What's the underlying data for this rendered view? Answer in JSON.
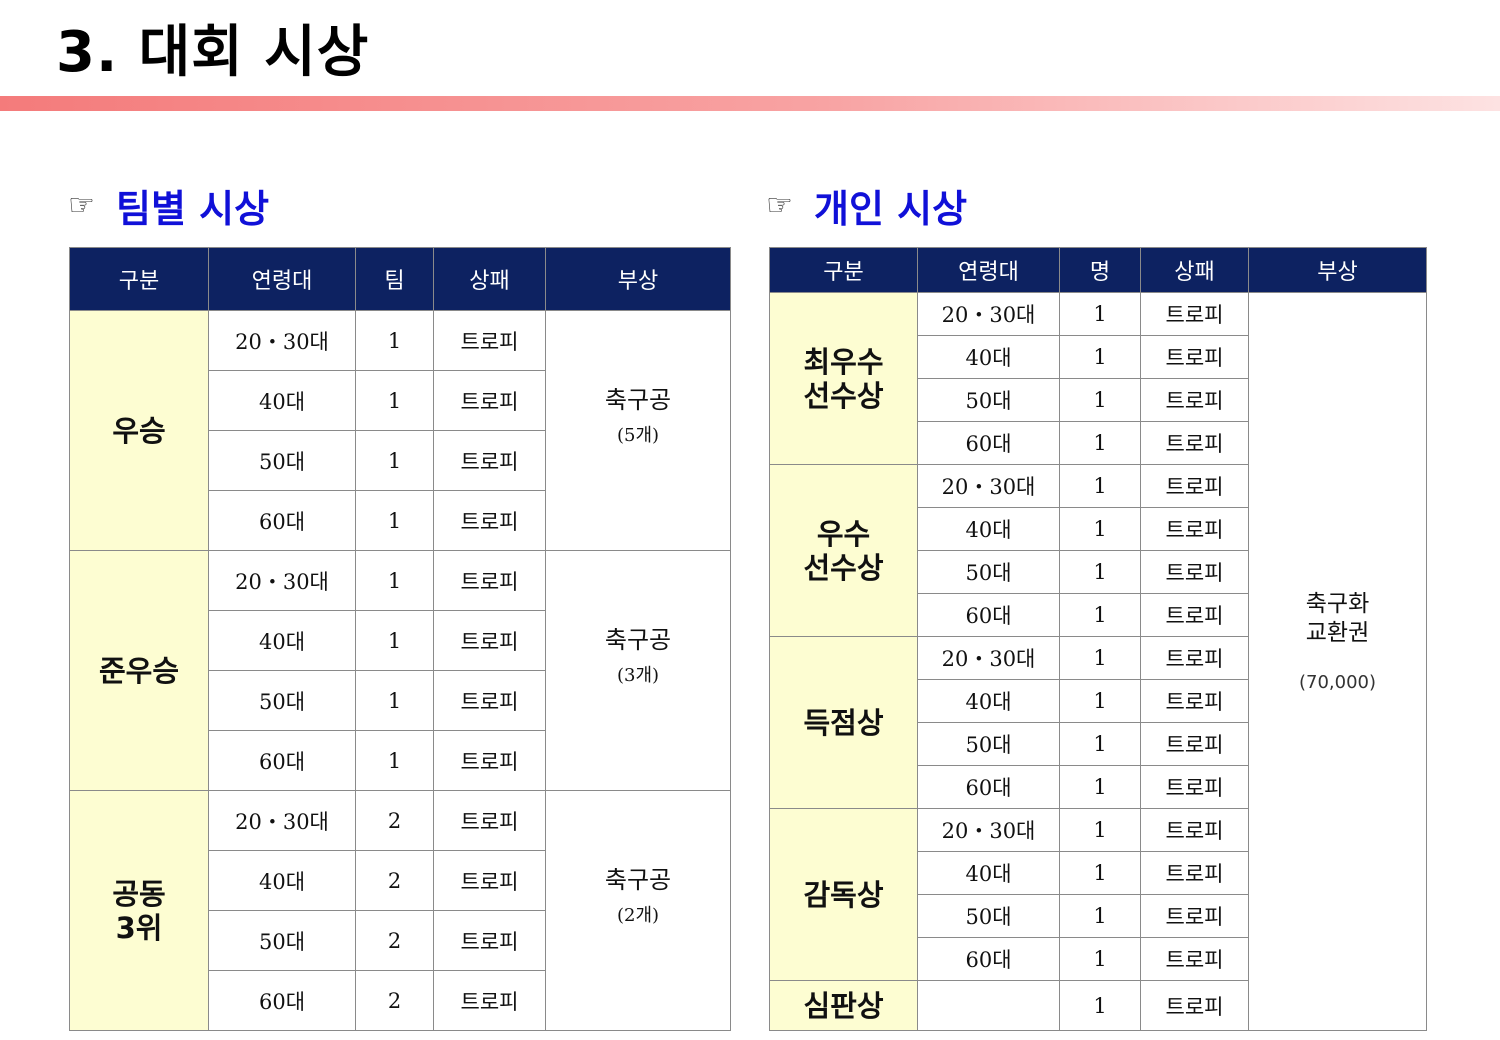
{
  "header": {
    "title": "3. 대회 시상"
  },
  "team": {
    "heading": "팀별 시상",
    "icon": "pointing-hand-icon",
    "columns": [
      "구분",
      "연령대",
      "팀",
      "상패",
      "부상"
    ],
    "groups": [
      {
        "name": "우승",
        "prize": "축구공",
        "prize_sub": "(5개)",
        "rows": [
          {
            "age": "20・30대",
            "count": "1",
            "plaque": "트로피"
          },
          {
            "age": "40대",
            "count": "1",
            "plaque": "트로피"
          },
          {
            "age": "50대",
            "count": "1",
            "plaque": "트로피"
          },
          {
            "age": "60대",
            "count": "1",
            "plaque": "트로피"
          }
        ]
      },
      {
        "name": "준우승",
        "prize": "축구공",
        "prize_sub": "(3개)",
        "rows": [
          {
            "age": "20・30대",
            "count": "1",
            "plaque": "트로피"
          },
          {
            "age": "40대",
            "count": "1",
            "plaque": "트로피"
          },
          {
            "age": "50대",
            "count": "1",
            "plaque": "트로피"
          },
          {
            "age": "60대",
            "count": "1",
            "plaque": "트로피"
          }
        ]
      },
      {
        "name": "공동\n3위",
        "prize": "축구공",
        "prize_sub": "(2개)",
        "rows": [
          {
            "age": "20・30대",
            "count": "2",
            "plaque": "트로피"
          },
          {
            "age": "40대",
            "count": "2",
            "plaque": "트로피"
          },
          {
            "age": "50대",
            "count": "2",
            "plaque": "트로피"
          },
          {
            "age": "60대",
            "count": "2",
            "plaque": "트로피"
          }
        ]
      }
    ]
  },
  "individual": {
    "heading": "개인 시상",
    "icon": "pointing-hand-icon",
    "columns": [
      "구분",
      "연령대",
      "명",
      "상패",
      "부상"
    ],
    "prize": "축구화\n교환권",
    "prize_sub": "(70,000)",
    "groups": [
      {
        "name": "최우수\n선수상",
        "rows": [
          {
            "age": "20・30대",
            "count": "1",
            "plaque": "트로피"
          },
          {
            "age": "40대",
            "count": "1",
            "plaque": "트로피"
          },
          {
            "age": "50대",
            "count": "1",
            "plaque": "트로피"
          },
          {
            "age": "60대",
            "count": "1",
            "plaque": "트로피"
          }
        ]
      },
      {
        "name": "우수\n선수상",
        "rows": [
          {
            "age": "20・30대",
            "count": "1",
            "plaque": "트로피"
          },
          {
            "age": "40대",
            "count": "1",
            "plaque": "트로피"
          },
          {
            "age": "50대",
            "count": "1",
            "plaque": "트로피"
          },
          {
            "age": "60대",
            "count": "1",
            "plaque": "트로피"
          }
        ]
      },
      {
        "name": "득점상",
        "rows": [
          {
            "age": "20・30대",
            "count": "1",
            "plaque": "트로피"
          },
          {
            "age": "40대",
            "count": "1",
            "plaque": "트로피"
          },
          {
            "age": "50대",
            "count": "1",
            "plaque": "트로피"
          },
          {
            "age": "60대",
            "count": "1",
            "plaque": "트로피"
          }
        ]
      },
      {
        "name": "감독상",
        "rows": [
          {
            "age": "20・30대",
            "count": "1",
            "plaque": "트로피"
          },
          {
            "age": "40대",
            "count": "1",
            "plaque": "트로피"
          },
          {
            "age": "50대",
            "count": "1",
            "plaque": "트로피"
          },
          {
            "age": "60대",
            "count": "1",
            "plaque": "트로피"
          }
        ]
      },
      {
        "name": "심판상",
        "rows": [
          {
            "age": "",
            "count": "1",
            "plaque": "트로피"
          }
        ]
      }
    ]
  },
  "colors": {
    "header_bg": "#0d2261",
    "category_bg": "#fdfdd2",
    "heading": "#1010d8",
    "title_bar": "#f47b7b"
  }
}
